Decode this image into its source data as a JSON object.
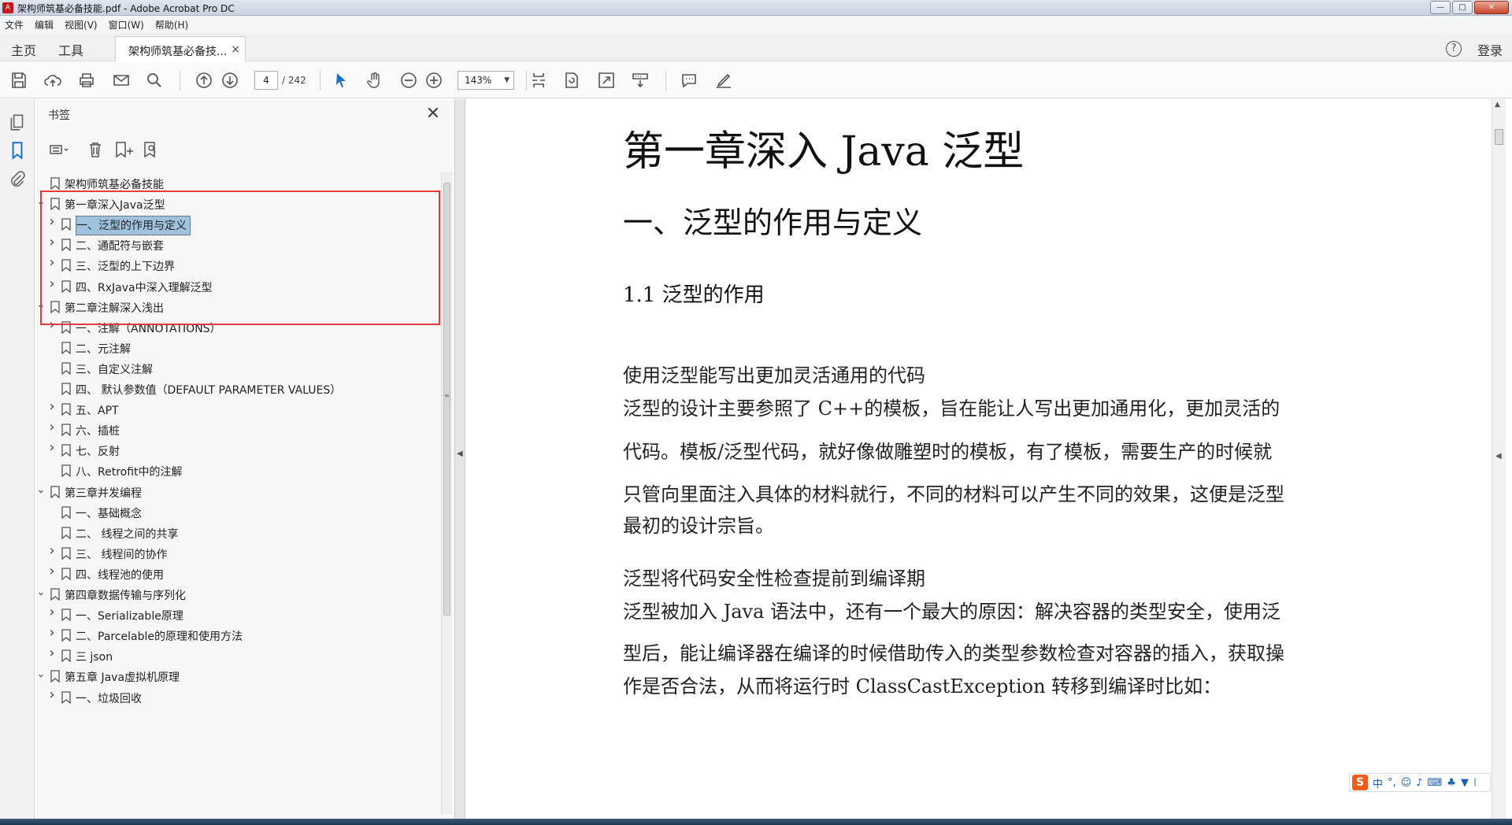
{
  "window": {
    "title": "架构师筑基必备技能.pdf - Adobe Acrobat Pro DC",
    "app_icon": "acrobat-icon",
    "controls": [
      "minimize",
      "maximize",
      "close"
    ]
  },
  "menu": [
    "文件",
    "编辑",
    "视图(V)",
    "窗口(W)",
    "帮助(H)"
  ],
  "tabs": {
    "home": "主页",
    "tools": "工具",
    "document": "架构师筑基必备技...",
    "close_glyph": "×",
    "help_glyph": "?",
    "login": "登录"
  },
  "toolbar": {
    "icons": [
      "save-icon",
      "upload-icon",
      "print-icon",
      "mail-icon",
      "search-icon",
      "page-up-icon",
      "page-down-icon",
      "select-arrow-icon",
      "hand-icon",
      "zoom-out-icon",
      "zoom-in-icon",
      "fit-page-icon",
      "rotate-icon",
      "fullscreen-icon",
      "scroll-mode-icon",
      "comment-icon",
      "sign-icon"
    ],
    "page_current": "4",
    "page_total": "/ 242",
    "zoom": "143%"
  },
  "left_rail": {
    "icons": [
      "pages-icon",
      "bookmark-icon",
      "attachment-icon"
    ]
  },
  "bookmarks": {
    "title": "书签",
    "close_glyph": "✕",
    "tool_icons": [
      "options-icon",
      "delete-icon",
      "new-bookmark-icon",
      "find-bookmark-icon"
    ],
    "items": [
      {
        "label": "架构师筑基必备技能",
        "level": 0,
        "expander": "none"
      },
      {
        "label": "第一章深入Java泛型",
        "level": 0,
        "expander": "expanded"
      },
      {
        "label": "一、泛型的作用与定义",
        "level": 1,
        "expander": "collapsed",
        "selected": true
      },
      {
        "label": "二、通配符与嵌套",
        "level": 1,
        "expander": "collapsed"
      },
      {
        "label": "三、泛型的上下边界",
        "level": 1,
        "expander": "collapsed"
      },
      {
        "label": "四、RxJava中深入理解泛型",
        "level": 1,
        "expander": "collapsed"
      },
      {
        "label": "第二章注解深入浅出",
        "level": 0,
        "expander": "expanded"
      },
      {
        "label": "一、注解（ANNOTATIONS）",
        "level": 1,
        "expander": "collapsed"
      },
      {
        "label": "二、元注解",
        "level": 1,
        "expander": "none"
      },
      {
        "label": "三、自定义注解",
        "level": 1,
        "expander": "none"
      },
      {
        "label": "四、 默认参数值（DEFAULT PARAMETER VALUES）",
        "level": 1,
        "expander": "none"
      },
      {
        "label": "五、APT",
        "level": 1,
        "expander": "collapsed"
      },
      {
        "label": "六、插桩",
        "level": 1,
        "expander": "collapsed"
      },
      {
        "label": "七、反射",
        "level": 1,
        "expander": "collapsed"
      },
      {
        "label": "八、Retrofit中的注解",
        "level": 1,
        "expander": "none"
      },
      {
        "label": "第三章并发编程",
        "level": 0,
        "expander": "expanded"
      },
      {
        "label": "一、基础概念",
        "level": 1,
        "expander": "none"
      },
      {
        "label": "二、 线程之间的共享",
        "level": 1,
        "expander": "none"
      },
      {
        "label": "三、 线程间的协作",
        "level": 1,
        "expander": "collapsed"
      },
      {
        "label": "四、线程池的使用",
        "level": 1,
        "expander": "collapsed"
      },
      {
        "label": "第四章数据传输与序列化",
        "level": 0,
        "expander": "expanded"
      },
      {
        "label": "一、Serializable原理",
        "level": 1,
        "expander": "collapsed"
      },
      {
        "label": "二、Parcelable的原理和使用方法",
        "level": 1,
        "expander": "collapsed"
      },
      {
        "label": "三 json",
        "level": 1,
        "expander": "collapsed"
      },
      {
        "label": "第五章 Java虚拟机原理",
        "level": 0,
        "expander": "expanded"
      },
      {
        "label": "一、垃圾回收",
        "level": 1,
        "expander": "collapsed"
      }
    ],
    "highlight_color": "#e53a3a"
  },
  "document": {
    "h1": "第一章深入 Java 泛型",
    "h2": "一、泛型的作用与定义",
    "h3": "1.1 泛型的作用",
    "lines": [
      "使用泛型能写出更加灵活通用的代码",
      "泛型的设计主要参照了 C++的模板，旨在能让人写出更加通用化，更加灵活的",
      "代码。模板/泛型代码，就好像做雕塑时的模板，有了模板，需要生产的时候就",
      "只管向里面注入具体的材料就行，不同的材料可以产生不同的效果，这便是泛型",
      "最初的设计宗旨。",
      "泛型将代码安全性检查提前到编译期",
      "泛型被加入 Java 语法中，还有一个最大的原因：解决容器的类型安全，使用泛",
      "型后，能让编译器在编译的时候借助传入的类型参数检查对容器的插入，获取操",
      "作是否合法，从而将运行时 ClassCastException 转移到编译时比如："
    ]
  },
  "ime": {
    "logo": "S",
    "mode": "中",
    "punct": "°,"
  }
}
